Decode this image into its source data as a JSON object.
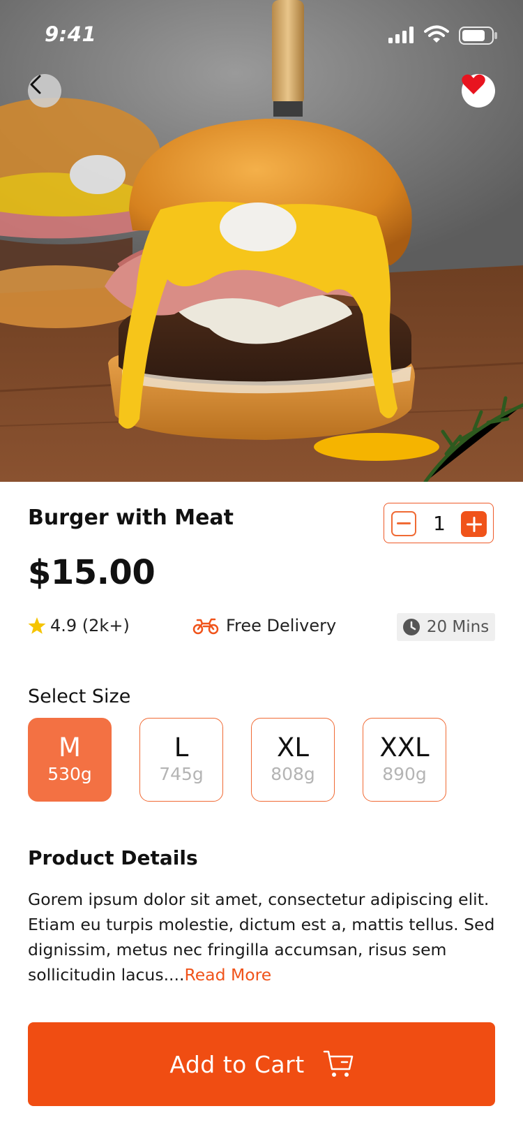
{
  "status_bar": {
    "time": "9:41"
  },
  "hero": {
    "alt": "Burger with Meat photo"
  },
  "product": {
    "title": "Burger with Meat",
    "price": "$15.00",
    "quantity": "1",
    "rating": "4.9 (2k+)",
    "delivery": "Free Delivery",
    "prep_time": "20 Mins"
  },
  "sizes": {
    "heading": "Select Size",
    "options": [
      {
        "label": "M",
        "weight": "530g",
        "selected": true
      },
      {
        "label": "L",
        "weight": "745g",
        "selected": false
      },
      {
        "label": "XL",
        "weight": "808g",
        "selected": false
      },
      {
        "label": "XXL",
        "weight": "890g",
        "selected": false
      }
    ]
  },
  "details": {
    "heading": "Product Details",
    "text": "Gorem ipsum dolor sit amet, consectetur adipiscing elit. Etiam eu turpis molestie, dictum est a, mattis tellus. Sed dignissim, metus nec fringilla accumsan, risus sem sollicitudin lacus....",
    "read_more": "Read More"
  },
  "cta": {
    "label": "Add to Cart"
  },
  "icons": {
    "back": "chevron-left-icon",
    "favorite": "heart-icon",
    "rating": "star-icon",
    "delivery": "motorbike-icon",
    "time": "clock-icon",
    "cart": "cart-icon",
    "minus": "minus-icon",
    "plus": "plus-icon"
  },
  "colors": {
    "accent": "#f04d12",
    "selected_size": "#f37143",
    "star": "#f5c400",
    "heart": "#e8141f",
    "muted": "#b4b4b4"
  }
}
